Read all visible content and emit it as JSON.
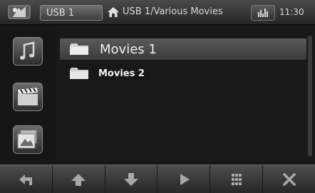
{
  "topbar": {
    "source_label": "USB 1",
    "path": "USB 1/Various Movies",
    "time": "11:30"
  },
  "sidebar": {
    "items": [
      {
        "name": "music",
        "icon": "music-note-icon"
      },
      {
        "name": "movies",
        "icon": "clapperboard-icon"
      },
      {
        "name": "photos",
        "icon": "photo-icon"
      }
    ]
  },
  "file_list": {
    "items": [
      {
        "label": "Movies 1",
        "type": "folder",
        "selected": true
      },
      {
        "label": "Movies 2",
        "type": "folder",
        "selected": false
      }
    ]
  },
  "bottombar": {
    "buttons": [
      {
        "name": "back",
        "icon": "back-arrow-icon"
      },
      {
        "name": "up",
        "icon": "arrow-up-icon"
      },
      {
        "name": "down",
        "icon": "arrow-down-icon"
      },
      {
        "name": "play",
        "icon": "play-icon"
      },
      {
        "name": "grid",
        "icon": "grid-icon"
      },
      {
        "name": "close",
        "icon": "close-icon"
      }
    ]
  },
  "colors": {
    "background": "#181818",
    "bar": "#3a3a3a",
    "text": "#f0f0f0",
    "selection": "#4c4c4c"
  }
}
